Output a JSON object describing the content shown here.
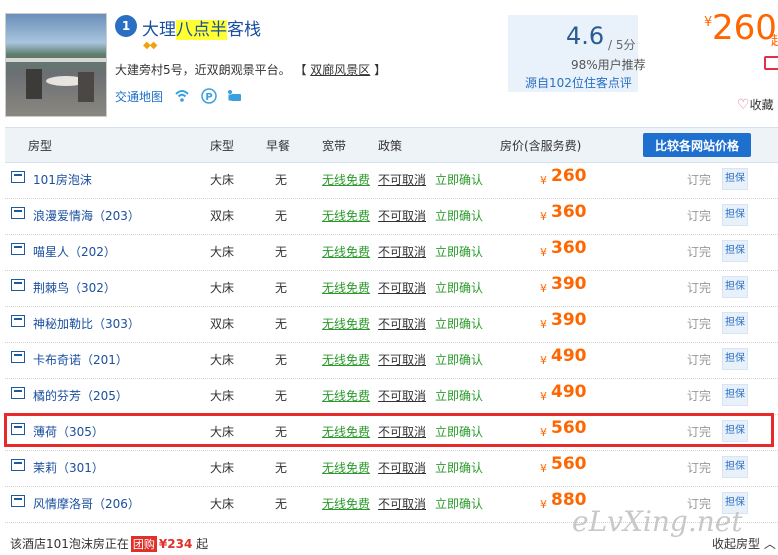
{
  "hotel": {
    "rank": "1",
    "name_prefix": "大理",
    "name_highlight": "八点半",
    "name_suffix": "客栈",
    "address": "大建旁村5号，近双朗观景平台。",
    "district": "双廊风景区",
    "map_link": "交通地图",
    "amenity_icons": [
      "wifi-icon",
      "parking-icon",
      "shuttle-icon"
    ]
  },
  "rating": {
    "score": "4.6",
    "unit": "/ 5分",
    "recommend": "98%用户推荐",
    "reviews": "源自102位住客点评"
  },
  "header_price": {
    "yen": "¥",
    "value": "260",
    "suffix": "起"
  },
  "favorite": "收藏",
  "table": {
    "headers": {
      "room": "房型",
      "bed": "床型",
      "breakfast": "早餐",
      "broadband": "宽带",
      "policy": "政策",
      "price": "房价(含服务费)"
    },
    "compare_button": "比较各网站价格",
    "rows": [
      {
        "room": "101房泡沫",
        "bed": "大床",
        "breakfast": "无",
        "wifi": "无线免费",
        "cancel": "不可取消",
        "confirm": "立即确认",
        "price": "260",
        "status": "订完",
        "guarantee": "担保"
      },
      {
        "room": "浪漫爱情海（203）",
        "bed": "双床",
        "breakfast": "无",
        "wifi": "无线免费",
        "cancel": "不可取消",
        "confirm": "立即确认",
        "price": "360",
        "status": "订完",
        "guarantee": "担保"
      },
      {
        "room": "喵星人（202）",
        "bed": "大床",
        "breakfast": "无",
        "wifi": "无线免费",
        "cancel": "不可取消",
        "confirm": "立即确认",
        "price": "360",
        "status": "订完",
        "guarantee": "担保"
      },
      {
        "room": "荆棘鸟（302）",
        "bed": "大床",
        "breakfast": "无",
        "wifi": "无线免费",
        "cancel": "不可取消",
        "confirm": "立即确认",
        "price": "390",
        "status": "订完",
        "guarantee": "担保"
      },
      {
        "room": "神秘加勒比（303）",
        "bed": "双床",
        "breakfast": "无",
        "wifi": "无线免费",
        "cancel": "不可取消",
        "confirm": "立即确认",
        "price": "390",
        "status": "订完",
        "guarantee": "担保"
      },
      {
        "room": "卡布奇诺（201）",
        "bed": "大床",
        "breakfast": "无",
        "wifi": "无线免费",
        "cancel": "不可取消",
        "confirm": "立即确认",
        "price": "490",
        "status": "订完",
        "guarantee": "担保"
      },
      {
        "room": "橘的芬芳（205）",
        "bed": "大床",
        "breakfast": "无",
        "wifi": "无线免费",
        "cancel": "不可取消",
        "confirm": "立即确认",
        "price": "490",
        "status": "订完",
        "guarantee": "担保"
      },
      {
        "room": "薄荷（305）",
        "bed": "大床",
        "breakfast": "无",
        "wifi": "无线免费",
        "cancel": "不可取消",
        "confirm": "立即确认",
        "price": "560",
        "status": "订完",
        "guarantee": "担保"
      },
      {
        "room": "茉莉（301）",
        "bed": "大床",
        "breakfast": "无",
        "wifi": "无线免费",
        "cancel": "不可取消",
        "confirm": "立即确认",
        "price": "560",
        "status": "订完",
        "guarantee": "担保"
      },
      {
        "room": "风情摩洛哥（206）",
        "bed": "大床",
        "breakfast": "无",
        "wifi": "无线免费",
        "cancel": "不可取消",
        "confirm": "立即确认",
        "price": "880",
        "status": "订完",
        "guarantee": "担保"
      }
    ],
    "yen": "¥"
  },
  "footer": {
    "text": "该酒店101泡沫房正在",
    "tuan": "团购",
    "price": "¥234",
    "suffix": "起",
    "collapse": "收起房型"
  },
  "watermark": "eLvXing.net",
  "colors": {
    "accent": "#f60",
    "link": "#1a4fa0",
    "highlight_border": "#e82a2a"
  }
}
